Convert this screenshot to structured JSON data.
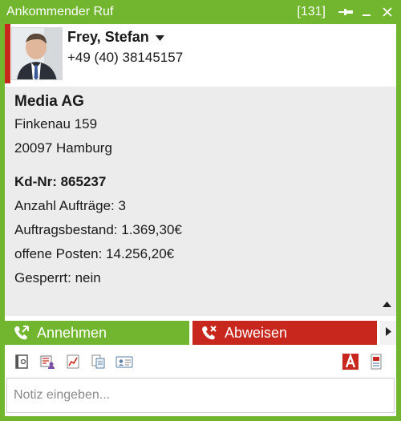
{
  "window": {
    "title": "Ankommender Ruf",
    "counter": "[131]",
    "accent": "#72b62f",
    "danger": "#c8271d"
  },
  "caller": {
    "name": "Frey, Stefan",
    "phone": "+49 (40) 38145157"
  },
  "customer": {
    "company": "Media AG",
    "street": "Finkenau 159",
    "city": "20097 Hamburg",
    "customer_no": "Kd-Nr: 865237",
    "orders": "Anzahl Aufträge: 3",
    "order_stock": "Auftragsbestand: 1.369,30€",
    "open_items": "offene Posten: 14.256,20€",
    "locked": "Gesperrt: nein"
  },
  "actions": {
    "accept_label": "Annehmen",
    "reject_label": "Abweisen"
  },
  "toolbar": {
    "icons": [
      "contact-card-icon",
      "contacts-icon",
      "chart-icon",
      "documents-icon",
      "business-card-icon",
      "pdf-icon",
      "report-icon"
    ]
  },
  "notes": {
    "placeholder": "Notiz eingeben..."
  }
}
